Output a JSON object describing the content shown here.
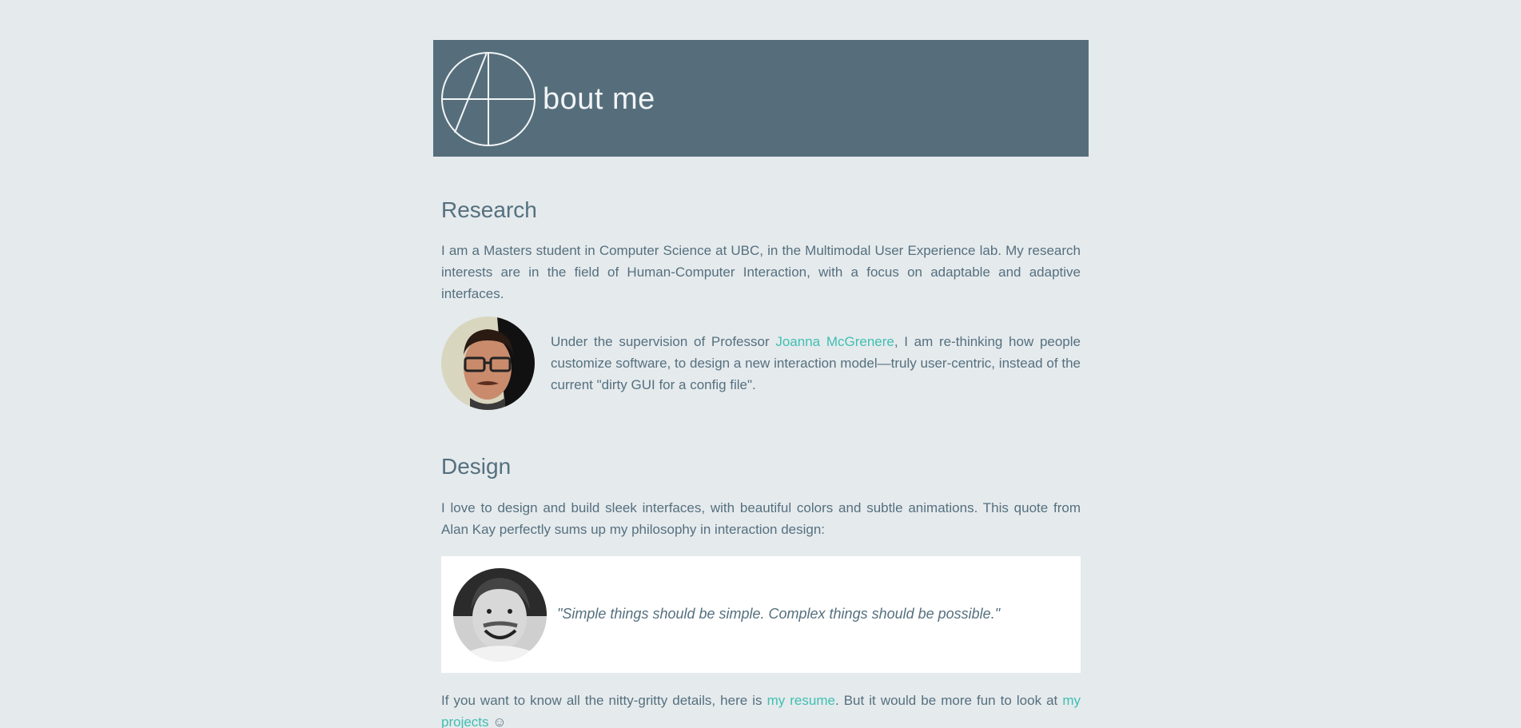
{
  "header": {
    "title": "bout me",
    "logo_icon": "circle-a-logo-icon"
  },
  "research": {
    "heading": "Research",
    "intro": "I am a Masters student in Computer Science at UBC, in the Multimodal User Experience lab. My research interests are in the field of Human-Computer Interaction, with a focus on adaptable and adaptive interfaces.",
    "supervision_prefix": "Under the supervision of Professor ",
    "supervisor_link": "Joanna McGrenere",
    "supervision_suffix": ", I am re-thinking how people customize software, to design a new interaction model—truly user-centric, instead of the current \"dirty GUI for a config file\"."
  },
  "design": {
    "heading": "Design",
    "intro": "I love to design and build sleek interfaces, with beautiful colors and subtle animations. This quote from Alan Kay perfectly sums up my philosophy in interaction design:",
    "quote": "\"Simple things should be simple. Complex things should be possible.\"",
    "closing_prefix": "If you want to know all the nitty-gritty details, here is ",
    "resume_link": "my resume",
    "closing_middle": ". But it would be more fun to look at ",
    "projects_link": "my projects",
    "closing_suffix": " ☺"
  },
  "colors": {
    "background": "#e5eaed",
    "header": "#566e7b",
    "text": "#55707e",
    "link": "#40bfb2"
  }
}
